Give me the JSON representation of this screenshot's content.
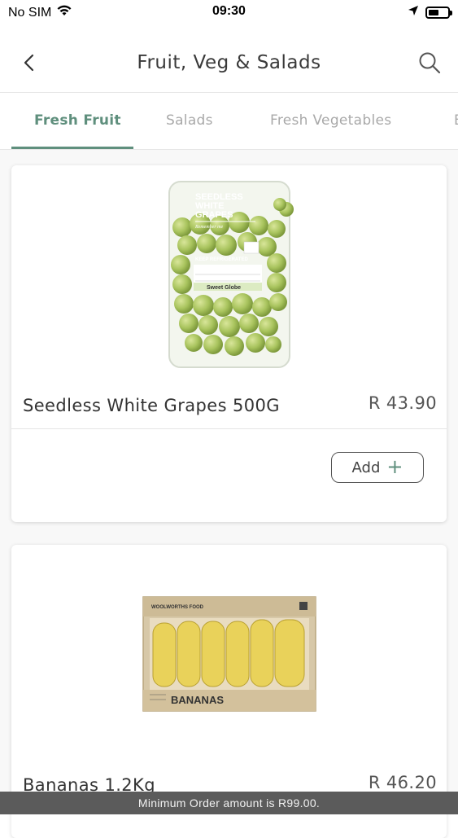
{
  "status_bar": {
    "carrier": "No SIM",
    "time": "09:30"
  },
  "header": {
    "title": "Fruit, Veg & Salads"
  },
  "tabs": [
    {
      "label": "Fresh Fruit",
      "active": true
    },
    {
      "label": "Salads",
      "active": false
    },
    {
      "label": "Fresh Vegetables",
      "active": false
    }
  ],
  "products": [
    {
      "name": "Seedless White Grapes 500G",
      "price": "R 43.90",
      "add_label": "Add",
      "image": "grapes-punnet",
      "pack_text": {
        "title_lines": [
          "SEEDLESS",
          "WHITE",
          "GRAPES"
        ],
        "tagline": "Remember me",
        "storage": "KEEP REFRIGERATED",
        "variety": "Sweet Globe"
      }
    },
    {
      "name": "Bananas 1.2Kg",
      "price": "R 46.20",
      "image": "bananas-box",
      "pack_text": {
        "brand": "WOOLWORTHS FOOD",
        "label": "BANANAS"
      }
    }
  ],
  "footer": {
    "min_order_text": "Minimum Order amount is R99.00."
  },
  "colors": {
    "accent": "#5f8f7d",
    "banner_bg": "#5b5b5b"
  }
}
